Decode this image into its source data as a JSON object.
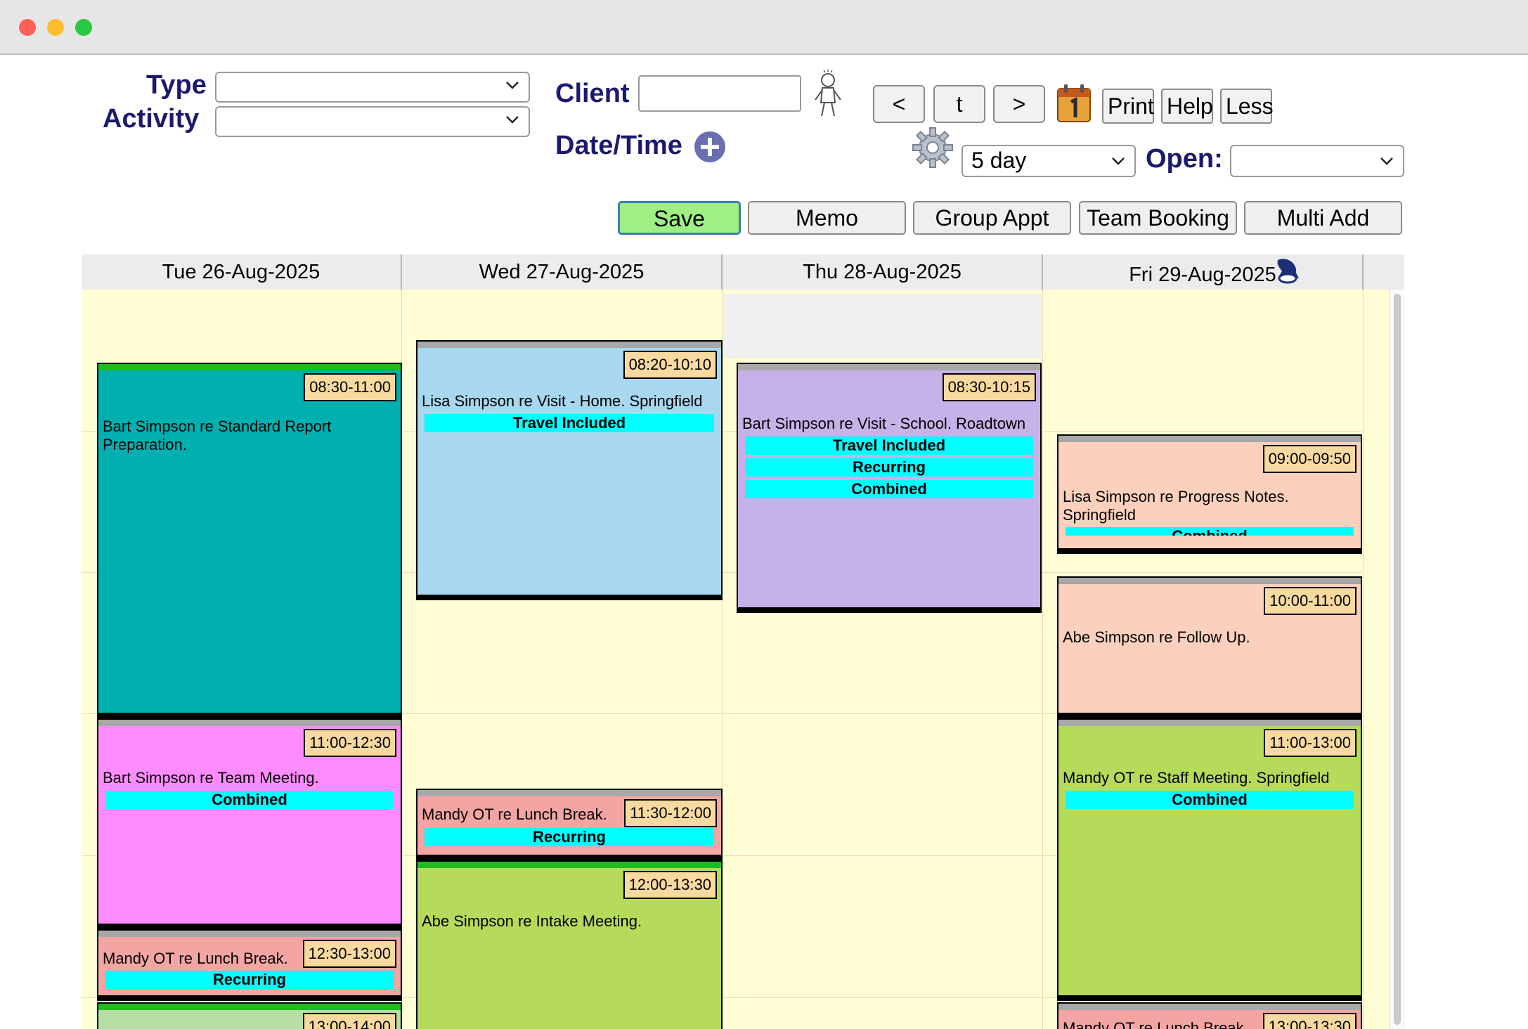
{
  "window": {
    "buttons": [
      "close",
      "minimize",
      "zoom"
    ],
    "colors": {
      "close": "#fe5f57",
      "minimize": "#febc2e",
      "zoom": "#28c840"
    }
  },
  "form": {
    "type_label": "Type",
    "activity_label": "Activity",
    "type_value": "",
    "activity_value": "",
    "client_label": "Client",
    "client_value": "",
    "datetime_label": "Date/Time"
  },
  "nav": {
    "prev": "<",
    "today": "t",
    "next": ">",
    "print": "Print",
    "help": "Help",
    "less": "Less",
    "view_value": "5 day",
    "open_label": "Open:",
    "open_value": ""
  },
  "actions": {
    "save": "Save",
    "memo": "Memo",
    "group": "Group Appt",
    "team": "Team Booking",
    "multi": "Multi Add"
  },
  "days": [
    "Tue 26-Aug-2025",
    "Wed 27-Aug-2025",
    "Thu 28-Aug-2025",
    "Fri 29-Aug-2025"
  ],
  "appointments": [
    {
      "time": "08:30-11:00",
      "text": "Bart Simpson re Standard Report Preparation.",
      "tags": []
    },
    {
      "time": "11:00-12:30",
      "text": "Bart Simpson re Team Meeting.",
      "tags": [
        "Combined"
      ]
    },
    {
      "time": "12:30-13:00",
      "text": "Mandy OT re Lunch Break.",
      "tags": [
        "Recurring"
      ]
    },
    {
      "time": "13:00-14:00",
      "text": "",
      "tags": []
    },
    {
      "time": "08:20-10:10",
      "text": "Lisa Simpson re Visit - Home. Springfield",
      "tags": [
        "Travel Included"
      ]
    },
    {
      "time": "11:30-12:00",
      "text": "Mandy OT re Lunch Break.",
      "tags": [
        "Recurring"
      ]
    },
    {
      "time": "12:00-13:30",
      "text": "Abe Simpson re Intake Meeting.",
      "tags": []
    },
    {
      "time": "08:30-10:15",
      "text": "Bart Simpson re Visit - School. Roadtown",
      "tags": [
        "Travel Included",
        "Recurring",
        "Combined"
      ]
    },
    {
      "time": "09:00-09:50",
      "text": "Lisa Simpson re Progress Notes. Springfield",
      "tags": [
        "Combined"
      ]
    },
    {
      "time": "10:00-11:00",
      "text": "Abe Simpson re Follow Up.",
      "tags": []
    },
    {
      "time": "11:00-13:00",
      "text": "Mandy OT re Staff Meeting. Springfield",
      "tags": [
        "Combined"
      ]
    },
    {
      "time": "13:00-13:30",
      "text": "Mandy OT re Lunch Break.",
      "tags": []
    }
  ],
  "colors": {
    "label": "#1a1a6e",
    "calendar_bg": "#fffed5",
    "time_badge": "#f8d9a0",
    "tag": "#00ffff",
    "save_button": "#9ef083",
    "appt_teal": "#00b0b0",
    "appt_pink": "#ff8cff",
    "appt_salmon": "#f2a5a2",
    "appt_lightblue": "#a7d8ef",
    "appt_green": "#b6da5a",
    "appt_lavender": "#c6b2e9",
    "appt_peach": "#fbd0bc"
  },
  "icons": [
    "chevron-down-icon",
    "person-icon",
    "add-circle-icon",
    "calendar-icon",
    "gear-icon",
    "bell-icon"
  ]
}
